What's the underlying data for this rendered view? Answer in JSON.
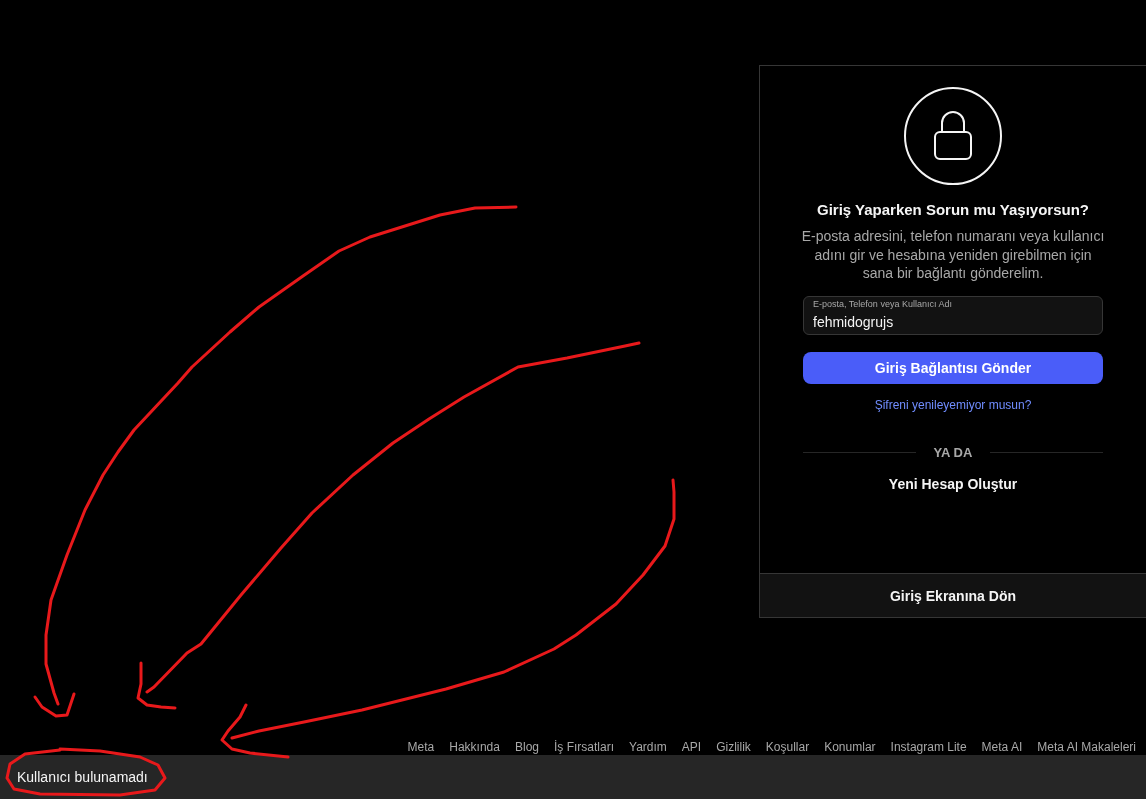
{
  "card": {
    "title": "Giriş Yaparken Sorun mu Yaşıyorsun?",
    "description": "E-posta adresini, telefon numaranı veya kullanıcı adını gir ve hesabına yeniden girebilmen için sana bir bağlantı gönderelim.",
    "field": {
      "label": "E-posta, Telefon veya Kullanıcı Adı",
      "value": "fehmidogrujs"
    },
    "submit_button": "Giriş Bağlantısı Gönder",
    "help_link": "Şifreni yenileyemiyor musun?",
    "divider": "YA DA",
    "create_account": "Yeni Hesap Oluştur",
    "back_button": "Giriş Ekranına Dön"
  },
  "footer": {
    "links": [
      "Meta",
      "Hakkında",
      "Blog",
      "İş Fırsatları",
      "Yardım",
      "API",
      "Gizlilik",
      "Koşullar",
      "Konumlar",
      "Instagram Lite",
      "Meta AI",
      "Meta AI Makaleleri"
    ]
  },
  "toast": {
    "message": "Kullanıcı bulunamadı"
  }
}
